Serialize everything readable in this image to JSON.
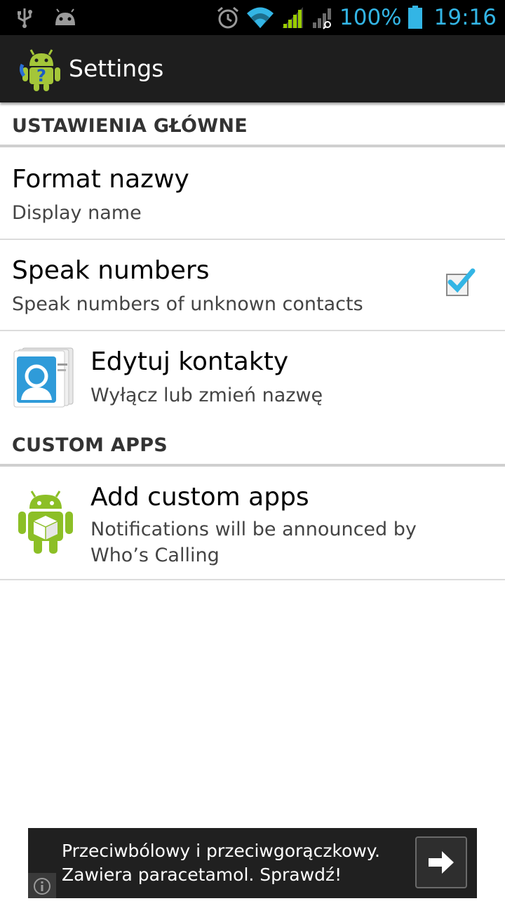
{
  "status_bar": {
    "icons": [
      "usb-icon",
      "android-debug-icon",
      "alarm-icon",
      "wifi-icon",
      "signal-icon",
      "signal-roaming-icon",
      "battery-icon"
    ],
    "battery": "100%",
    "time": "19:16",
    "accent_color": "#33b5e5"
  },
  "action_bar": {
    "title": "Settings",
    "icon": "app-logo-android-question-icon"
  },
  "sections": [
    {
      "header": "USTAWIENIA GŁÓWNE",
      "items": [
        {
          "title": "Format nazwy",
          "summary": "Display name"
        },
        {
          "title": "Speak numbers",
          "summary": "Speak numbers of unknown contacts",
          "checked": true
        },
        {
          "title": "Edytuj kontakty",
          "summary": "Wyłącz lub zmień nazwę",
          "icon": "contacts-card-icon"
        }
      ]
    },
    {
      "header": "CUSTOM APPS",
      "items": [
        {
          "title": "Add custom apps",
          "summary_line1": "Notifications will be announced by",
          "summary_line2": "Who’s Calling",
          "icon": "android-package-icon"
        }
      ]
    }
  ],
  "ad": {
    "line1": "Przeciwbólowy i przeciwgorączkowy.",
    "line2": "Zawiera paracetamol. Sprawdź!",
    "button_icon": "arrow-right-icon",
    "info_icon": "info-icon"
  }
}
